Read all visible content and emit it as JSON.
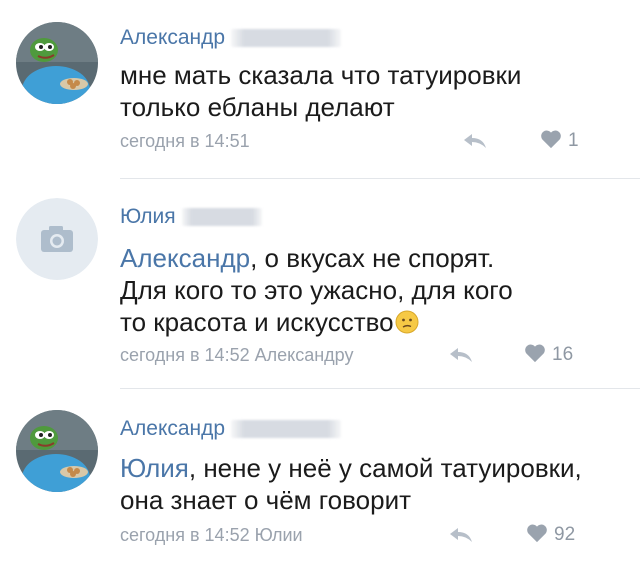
{
  "comments": [
    {
      "author": "Александр",
      "avatar": "pepe-frog-avatar",
      "text_lines": [
        "мне мать сказала что татуировки",
        "только ебланы делают"
      ],
      "timestamp": "сегодня в 14:51",
      "reply_to": "",
      "likes": "1"
    },
    {
      "author": "Юлия",
      "avatar": "camera-placeholder-avatar",
      "mention": "Александр",
      "text_lines": [
        ", о вкусах не спорят.",
        "Для кого то это ужасно,  для кого",
        "то красота и искусство"
      ],
      "emoji": "confused-face-emoji",
      "timestamp": "сегодня в 14:52",
      "reply_to": "Александру",
      "likes": "16"
    },
    {
      "author": "Александр",
      "avatar": "pepe-frog-avatar",
      "mention": "Юлия",
      "text_lines": [
        ", нене у неё у самой татуировки,",
        "она знает о чём говорит"
      ],
      "timestamp": "сегодня в 14:52",
      "reply_to": "Юлии",
      "likes": "92"
    }
  ],
  "colors": {
    "link": "#4a76a8",
    "meta": "#9aa2ad",
    "text": "#1b1b1b",
    "divider": "#e3e6ea"
  }
}
